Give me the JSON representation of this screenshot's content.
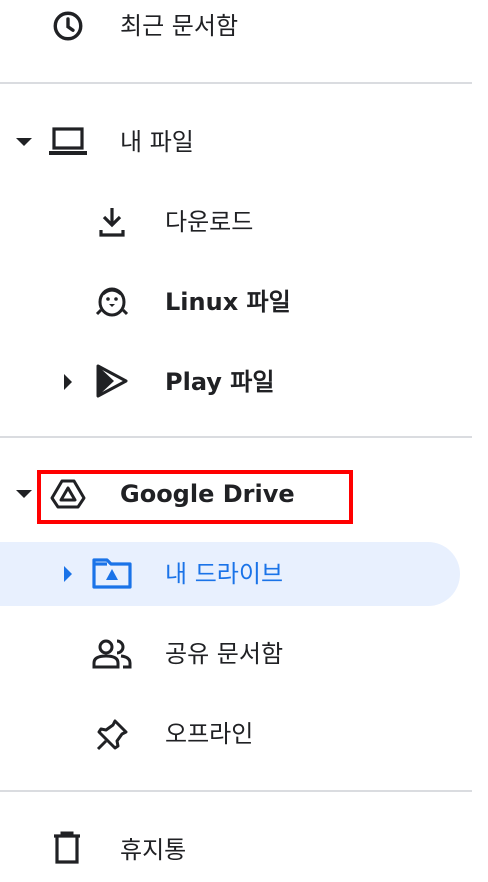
{
  "nav": {
    "recent": {
      "label": "최근 문서함",
      "icon": "clock-icon"
    },
    "my_files": {
      "label": "내 파일",
      "icon": "laptop-icon"
    },
    "downloads": {
      "label": "다운로드",
      "icon": "download-icon"
    },
    "linux_files": {
      "label": "Linux 파일",
      "icon": "penguin-icon"
    },
    "play_files": {
      "label": "Play 파일",
      "icon": "play-icon"
    },
    "google_drive": {
      "label": "Google Drive",
      "icon": "drive-icon"
    },
    "my_drive": {
      "label": "내 드라이브",
      "icon": "drive-folder-icon"
    },
    "shared": {
      "label": "공유 문서함",
      "icon": "people-icon"
    },
    "offline": {
      "label": "오프라인",
      "icon": "pin-icon"
    },
    "trash": {
      "label": "휴지통",
      "icon": "trash-icon"
    }
  },
  "colors": {
    "selected_bg": "#e8f0fe",
    "selected_text": "#1a73e8",
    "highlight": "#ff0000"
  }
}
